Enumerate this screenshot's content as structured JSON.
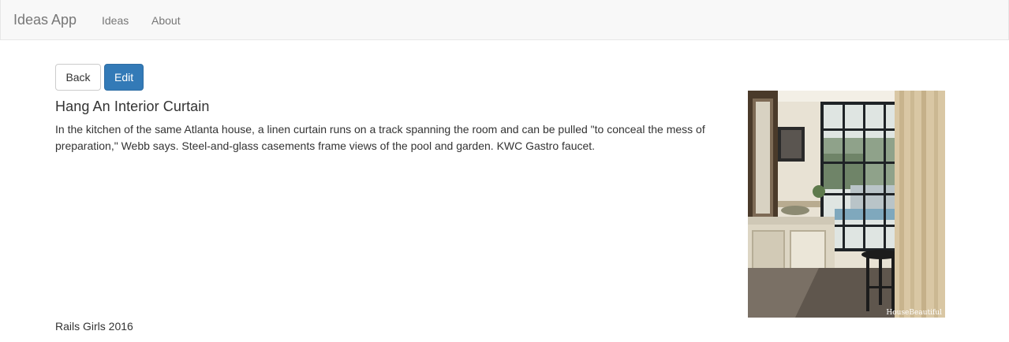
{
  "navbar": {
    "brand": "Ideas App",
    "links": [
      {
        "label": "Ideas"
      },
      {
        "label": "About"
      }
    ]
  },
  "actions": {
    "back_label": "Back",
    "edit_label": "Edit"
  },
  "idea": {
    "title": "Hang An Interior Curtain",
    "description": "In the kitchen of the same Atlanta house, a linen curtain runs on a track spanning the room and can be pulled \"to conceal the mess of preparation,\" Webb says. Steel-and-glass casements frame views of the pool and garden. KWC Gastro faucet.",
    "image_watermark": "HouseBeautiful"
  },
  "footer": {
    "text": "Rails Girls 2016"
  }
}
